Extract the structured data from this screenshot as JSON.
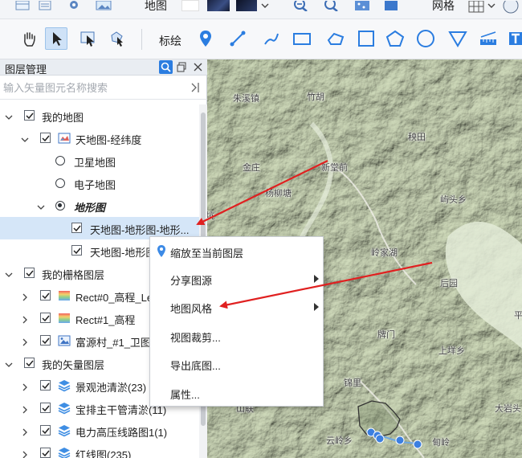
{
  "toolbar1": {
    "map_label": "地图",
    "grid_label": "网格"
  },
  "toolbar2": {
    "annotation_label": "标绘"
  },
  "layer_panel": {
    "title": "图层管理",
    "search": {
      "placeholder": "输入矢量图元名称搜索"
    }
  },
  "tree": [
    {
      "label": "我的地图",
      "icon": "none",
      "control": "checkbox",
      "checked": true,
      "expanded": true
    },
    {
      "label": "天地图-经纬度",
      "icon": "map-book-icon",
      "control": "checkbox",
      "checked": true,
      "expanded": true
    },
    {
      "label": "卫星地图",
      "icon": "none",
      "control": "radio",
      "checked": false
    },
    {
      "label": "电子地图",
      "icon": "none",
      "control": "radio",
      "checked": false
    },
    {
      "label": "地形图",
      "icon": "none",
      "control": "radio",
      "checked": true,
      "expanded": true,
      "style": "bold-italic"
    },
    {
      "label": "天地图-地形图-地形...",
      "icon": "none",
      "control": "checkbox",
      "checked": true,
      "selected": true
    },
    {
      "label": "天地图-地形图",
      "icon": "none",
      "control": "checkbox",
      "checked": true
    },
    {
      "label": "我的栅格图层",
      "icon": "none",
      "control": "checkbox",
      "checked": true,
      "expanded": true
    },
    {
      "label": "Rect#0_高程_Le",
      "icon": "raster-gradient-icon",
      "control": "checkbox",
      "checked": true,
      "expanded": false
    },
    {
      "label": "Rect#1_高程",
      "icon": "raster-gradient-icon",
      "control": "checkbox",
      "checked": true,
      "expanded": false
    },
    {
      "label": "富源村_#1_卫图",
      "icon": "image-icon",
      "control": "checkbox",
      "checked": true,
      "expanded": false
    },
    {
      "label": "我的矢量图层",
      "icon": "none",
      "control": "checkbox",
      "checked": true,
      "expanded": true
    },
    {
      "label": "景观池清淤(23)",
      "icon": "vector-layers-icon",
      "control": "checkbox",
      "checked": true,
      "expanded": false
    },
    {
      "label": "宝排主干管清淤(11)",
      "icon": "vector-layers-icon",
      "control": "checkbox",
      "checked": true,
      "expanded": false
    },
    {
      "label": "电力高压线路图1(1)",
      "icon": "vector-layers-icon",
      "control": "checkbox",
      "checked": true,
      "expanded": false
    },
    {
      "label": "红线图(235)",
      "icon": "vector-layers-icon",
      "control": "checkbox",
      "checked": true,
      "expanded": false
    }
  ],
  "context_menu": [
    {
      "label": "缩放至当前图层",
      "icon": "location-pin-icon",
      "submenu": false
    },
    {
      "label": "分享图源",
      "icon": "none",
      "submenu": true
    },
    {
      "label": "地图风格",
      "icon": "none",
      "submenu": true
    },
    {
      "label": "视图裁剪...",
      "icon": "none",
      "submenu": false
    },
    {
      "label": "导出底图...",
      "icon": "none",
      "submenu": false
    },
    {
      "label": "属性...",
      "icon": "none",
      "submenu": false
    }
  ],
  "map": {
    "places": [
      "朱溪镇",
      "竹胡",
      "秧田",
      "金庄",
      "新堂前",
      "杨柳塘",
      "屿头乡",
      "岭家湖",
      "后园",
      "上垟乡",
      "牌门",
      "锦里",
      "平",
      "大岩头",
      "山联",
      "云岭乡",
      "甸岭",
      "坑"
    ]
  },
  "colors": {
    "accent": "#1e6fd9",
    "annotation_arrow": "#e02020",
    "selection_bg": "#d5e6f8",
    "map_terrain": "#cfdcb9"
  }
}
